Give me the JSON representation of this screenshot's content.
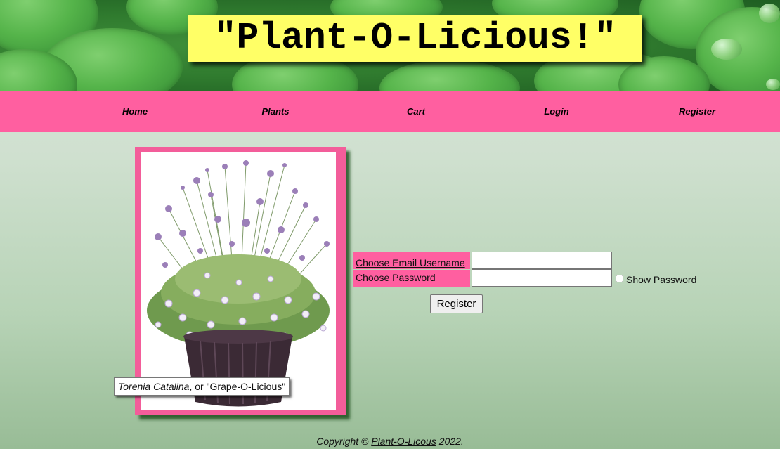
{
  "header": {
    "title": "\"Plant-O-Licious!\""
  },
  "nav": {
    "items": [
      {
        "label": "Home"
      },
      {
        "label": "Plants"
      },
      {
        "label": "Cart"
      },
      {
        "label": "Login"
      },
      {
        "label": "Register"
      }
    ]
  },
  "plant": {
    "image": "plant-photo",
    "caption_species": "Torenia Catalina",
    "caption_rest": ", or \"Grape-O-Licious\""
  },
  "form": {
    "email_label": "Choose Email Username",
    "email_value": "",
    "password_label": "Choose Password",
    "password_value": "",
    "show_password_label": "Show Password",
    "show_password_checked": false,
    "submit_label": "Register"
  },
  "footer": {
    "prefix": "Copyright © ",
    "link_text": "Plant-O-Licous",
    "suffix": " 2022."
  },
  "colors": {
    "nav_bg": "#ff5fa0",
    "title_bg": "#ffff66",
    "frame": "#f35d9a"
  }
}
